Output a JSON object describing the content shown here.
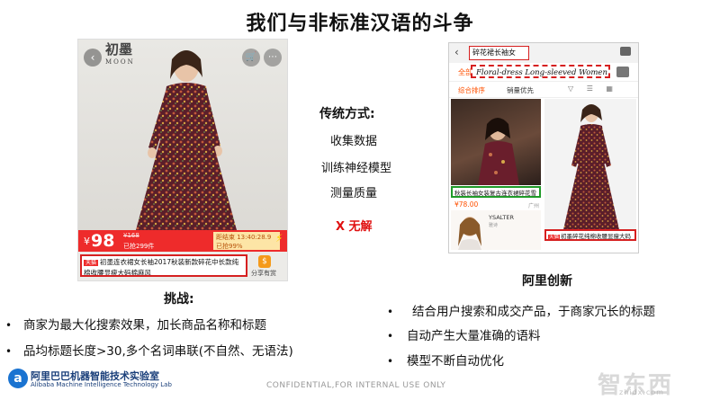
{
  "title": "我们与非标准汉语的斗争",
  "left_product": {
    "brand_cn": "初墨",
    "brand_en": "MOON",
    "currency": "¥",
    "price": "98",
    "original_price": "¥168",
    "sold": "已抢299件",
    "countdown_label": "距结束 13:40:28.9",
    "countdown_progress": "已抢99%",
    "progress_fraction": 0.99,
    "tag": "天猫",
    "title_text": "初墨连衣裙女长袖2017秋装新款碎花中长款纯棉收腰显瘦大码棉麻风",
    "share_label": "分享有赏"
  },
  "middle": {
    "heading": "传统方式:",
    "items": [
      "收集数据",
      "训练神经模型",
      "测量质量"
    ],
    "result": "X 无解"
  },
  "right_phone": {
    "search_query": "碎花裙长袖女",
    "tab_all": "全部",
    "hint_text": "Floral-dress Long-sleeved Women",
    "filter_sort": "综合排序",
    "filter_mall": "销量优先",
    "left_item_caption": "秋装长袖女装复古连衣裙碎花雪",
    "left_item_price": "¥78.00",
    "left_item_location": "广州",
    "ad_brand": "YSALTER",
    "ad_sub": "雅诗",
    "right_item_tag": "天猫",
    "right_item_caption": "初墨碎花纯棉收腰显瘦大码"
  },
  "challenge": {
    "label": "挑战:",
    "bullets": [
      "商家为最大化搜索效果，加长商品名称和标题",
      "品均标题长度>30,多个名词串联(不自然、无语法)"
    ]
  },
  "innovation": {
    "label": "阿里创新",
    "bullets": [
      "结合用户搜索和成交产品，于商家冗长的标题",
      "自动产生大量准确的语料",
      "模型不断自动优化"
    ]
  },
  "footer": {
    "lab_cn": "阿里巴巴机器智能技术实验室",
    "lab_en": "Alibaba Machine Intelligence Technology Lab",
    "confidential": "CONFIDENTIAL,FOR INTERNAL USE ONLY",
    "watermark_cn": "智东西",
    "watermark_en": "zhidx.com"
  },
  "bullet_char": "•",
  "colors": {
    "accent_red": "#ee2b2b",
    "highlight_red": "#d62020",
    "highlight_green": "#1f9a28",
    "taobao_orange": "#ff5000",
    "lab_blue": "#1a3f7a"
  }
}
